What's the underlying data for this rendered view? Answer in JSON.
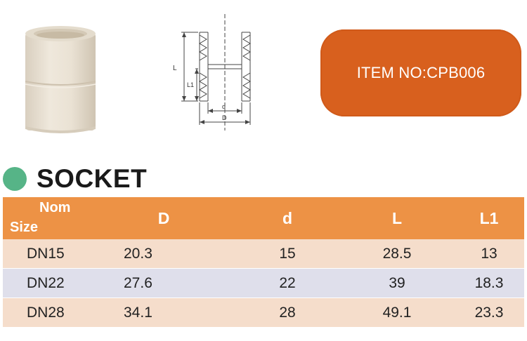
{
  "item_badge": {
    "text": "ITEM NO:CPB006",
    "color": "#d8601e"
  },
  "drawing_labels": {
    "length": "L",
    "socket_depth": "L1",
    "inner_diameter": "d",
    "outer_diameter": "D"
  },
  "section": {
    "title": "SOCKET",
    "bullet_color": "#56b487"
  },
  "table": {
    "header": {
      "nom": "Nom",
      "size": "Size",
      "columns": [
        "D",
        "d",
        "L",
        "L1"
      ]
    },
    "header_color": "#ed9245",
    "rows": [
      {
        "size": "DN15",
        "D": "20.3",
        "d": "15",
        "L": "28.5",
        "L1": "13"
      },
      {
        "size": "DN22",
        "D": "27.6",
        "d": "22",
        "L": "39",
        "L1": "18.3"
      },
      {
        "size": "DN28",
        "D": "34.1",
        "d": "28",
        "L": "49.1",
        "L1": "23.3"
      }
    ]
  }
}
